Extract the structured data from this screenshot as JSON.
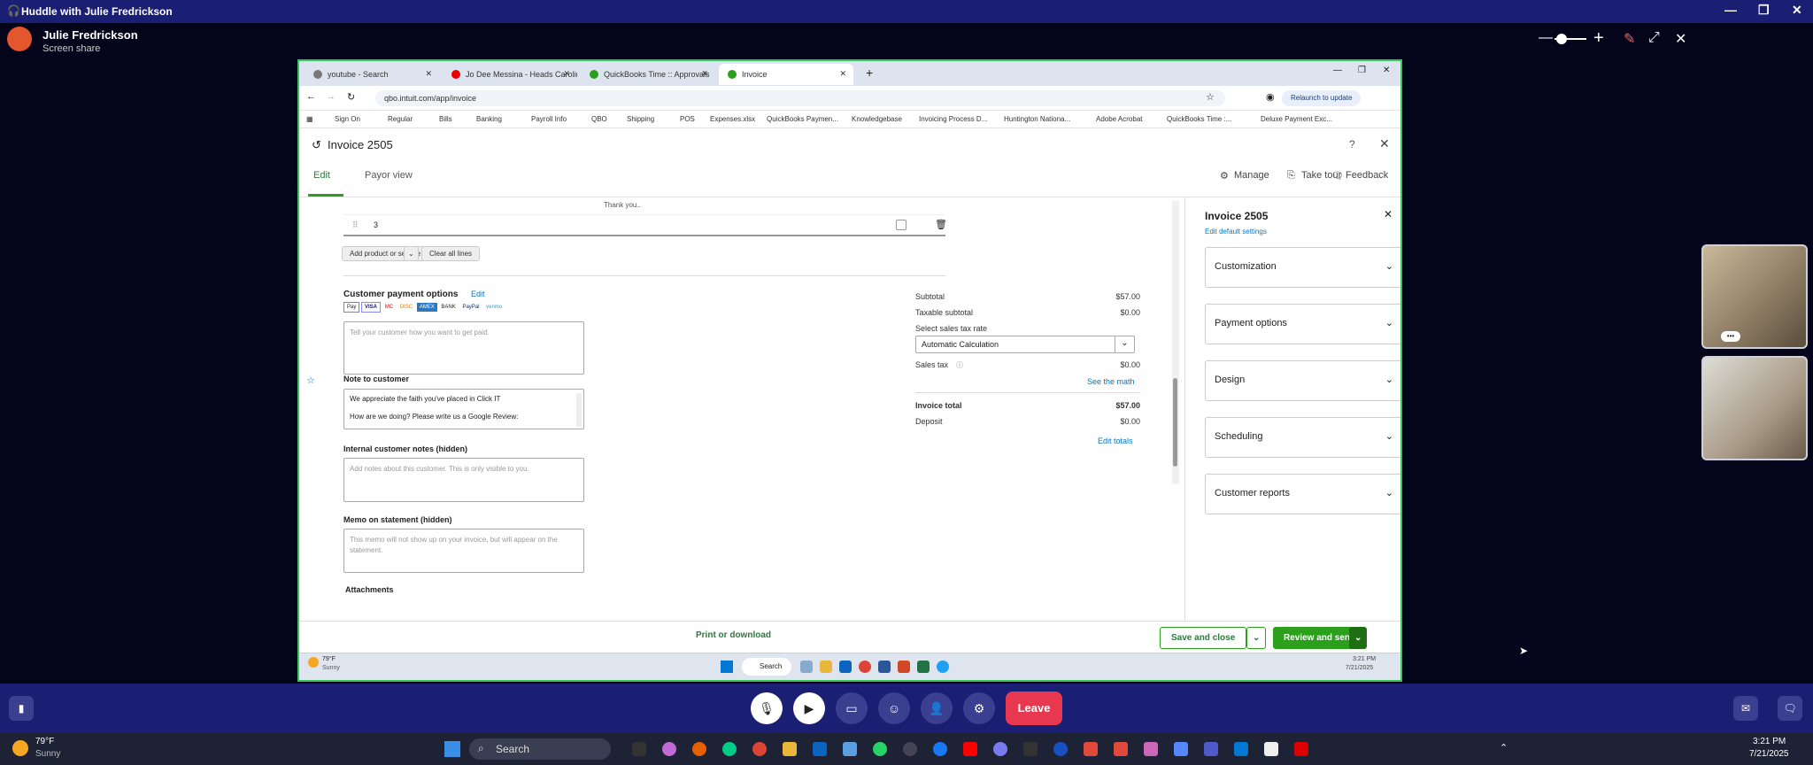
{
  "app": {
    "title": "Huddle with Julie Fredrickson"
  },
  "presenter": {
    "name": "Julie Fredrickson",
    "subtitle": "Screen share"
  },
  "browser": {
    "tabs": [
      {
        "label": "youtube - Search",
        "color": "#777"
      },
      {
        "label": "Jo Dee Messina - Heads Carolin",
        "color": "#e00"
      },
      {
        "label": "QuickBooks Time :: Approvals",
        "color": "#2ca01c"
      },
      {
        "label": "Invoice",
        "color": "#2ca01c"
      }
    ],
    "url": "qbo.intuit.com/app/invoice",
    "relaunch": "Relaunch to update",
    "bookmarks": [
      "Sign On",
      "Regular",
      "Bills",
      "Banking",
      "Payroll Info",
      "QBO",
      "Shipping",
      "POS",
      "Expenses.xlsx",
      "QuickBooks Paymen...",
      "Knowledgebase",
      "Invoicing Process D...",
      "Huntington Nationa...",
      "Adobe Acrobat",
      "QuickBooks Time :...",
      "Deluxe Payment Exc..."
    ]
  },
  "qb": {
    "title": "Invoice 2505",
    "tabs": [
      "Edit",
      "Payor view"
    ],
    "header_links": [
      "Manage",
      "Take tour",
      "Feedback"
    ],
    "line_message": "Thank you..",
    "row_number": "3",
    "add_product": "Add product or service",
    "clear_lines": "Clear all lines",
    "payment_options_label": "Customer payment options",
    "payment_edit": "Edit",
    "payment_methods": [
      "Pay",
      "VISA",
      "MC",
      "DISC",
      "AMEX",
      "BANK",
      "PayPal",
      "venmo"
    ],
    "payment_placeholder": "Tell your customer how you want to get paid.",
    "note_label": "Note to customer",
    "note_line1": "We appreciate the faith you've placed in Click IT",
    "note_line2": "How are we doing? Please write us a Google Review:",
    "internal_label": "Internal customer notes (hidden)",
    "internal_placeholder": "Add notes about this customer. This is only visible to you.",
    "memo_label": "Memo on statement (hidden)",
    "memo_placeholder": "This memo will not show up on your invoice, but will appear on the statement.",
    "attachments_label": "Attachments",
    "totals": {
      "subtotal_label": "Subtotal",
      "subtotal": "$57.00",
      "taxable_label": "Taxable subtotal",
      "taxable": "$0.00",
      "tax_rate_label": "Select sales tax rate",
      "tax_rate": "Automatic Calculation",
      "sales_tax_label": "Sales tax",
      "sales_tax": "$0.00",
      "see_math": "See the math",
      "invoice_total_label": "Invoice total",
      "invoice_total": "$57.00",
      "deposit_label": "Deposit",
      "deposit": "$0.00",
      "edit_totals": "Edit totals"
    },
    "panel": {
      "title": "Invoice 2505",
      "edit_defaults": "Edit default settings",
      "sections": [
        "Customization",
        "Payment options",
        "Design",
        "Scheduling",
        "Customer reports"
      ]
    },
    "footer": {
      "print": "Print or download",
      "save_close": "Save and close",
      "review_send": "Review and send"
    }
  },
  "inner_taskbar": {
    "temp": "79°F",
    "weather": "Sunny",
    "search": "Search",
    "time": "3:21 PM",
    "date": "7/21/2025"
  },
  "controls": {
    "leave": "Leave"
  },
  "taskbar": {
    "temp": "79°F",
    "weather": "Sunny",
    "search": "Search",
    "time": "3:21 PM",
    "date": "7/21/2025"
  },
  "colors": {
    "qb_green": "#2ca01c",
    "leave_red": "#e8384f",
    "huddle_bar": "#1b1f73",
    "share_border": "#35c759"
  }
}
